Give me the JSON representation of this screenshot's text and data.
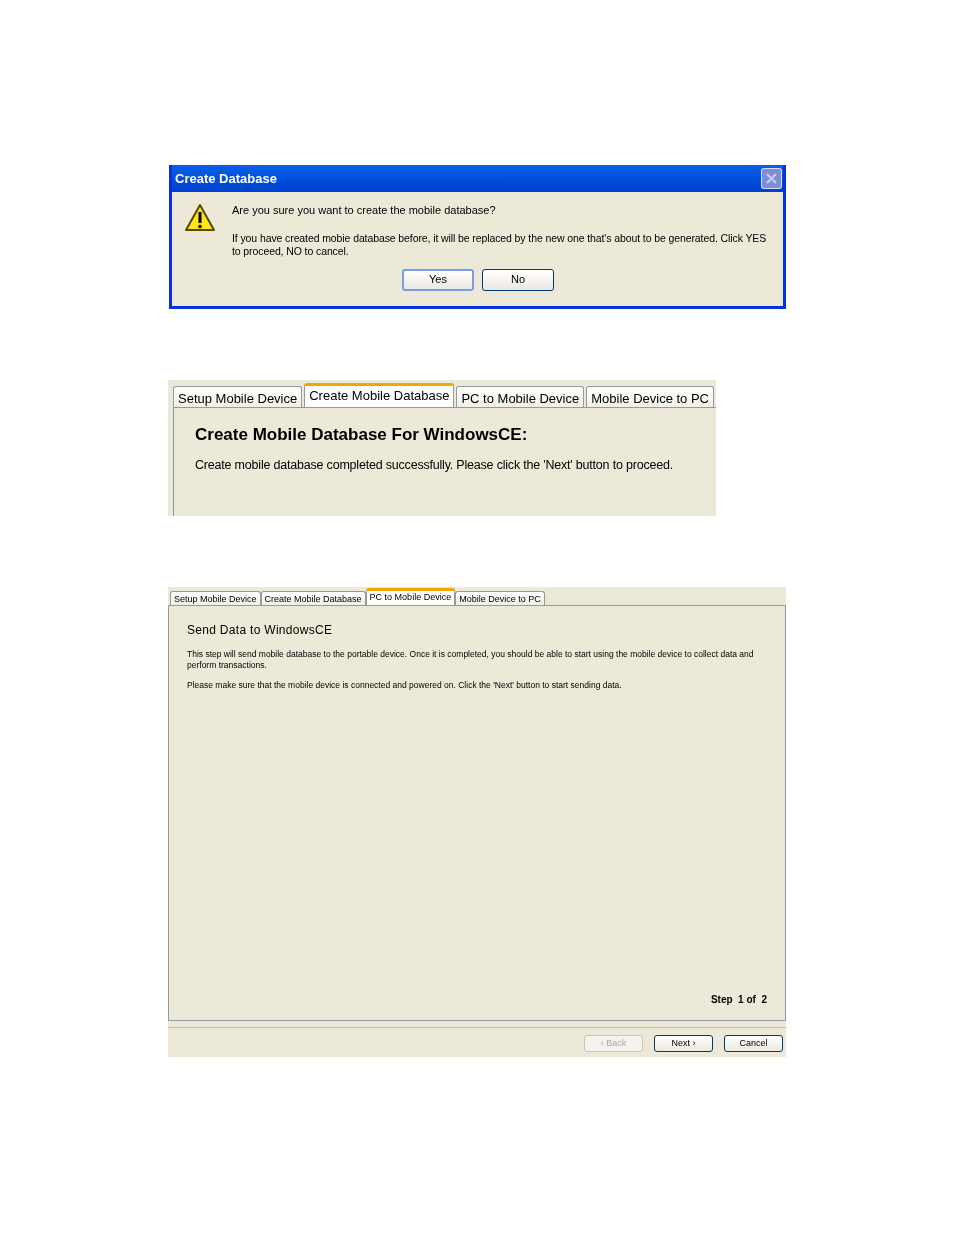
{
  "confirm_dialog": {
    "title": "Create Database",
    "question": "Are you sure you want to create the mobile database?",
    "detail": "If you have created mobie database before, it will be replaced by the new one that's about to be generated. Click YES to proceed, NO to cancel.",
    "buttons": [
      {
        "label": "Yes",
        "focused": true
      },
      {
        "label": "No",
        "focused": false
      }
    ]
  },
  "create_panel": {
    "tabs": [
      {
        "label": "Setup Mobile Device",
        "selected": false
      },
      {
        "label": "Create Mobile Database",
        "selected": true
      },
      {
        "label": "PC to Mobile Device",
        "selected": false
      },
      {
        "label": "Mobile Device to PC",
        "selected": false
      }
    ],
    "heading": "Create Mobile Database For WindowsCE:",
    "message": "Create mobile database completed successfully. Please click the 'Next' button to proceed."
  },
  "send_panel": {
    "tabs": [
      {
        "label": "Setup Mobile Device",
        "selected": false
      },
      {
        "label": "Create Mobile Database",
        "selected": false
      },
      {
        "label": "PC to Mobile Device",
        "selected": true
      },
      {
        "label": "Mobile Device to PC",
        "selected": false
      }
    ],
    "heading": "Send Data to WindowsCE",
    "paragraphs": [
      "This step will send mobile database to the portable device. Once it is completed, you should be able to start using the mobile device to collect data and perform transactions.",
      "Please make sure that the mobile device is connected and powered on. Click the 'Next' button to start sending data."
    ],
    "step": "Step  1 of  2",
    "buttons": [
      {
        "label": "‹ Back",
        "disabled": true
      },
      {
        "label": "Next ›",
        "disabled": false
      },
      {
        "label": "Cancel",
        "disabled": false
      }
    ]
  }
}
